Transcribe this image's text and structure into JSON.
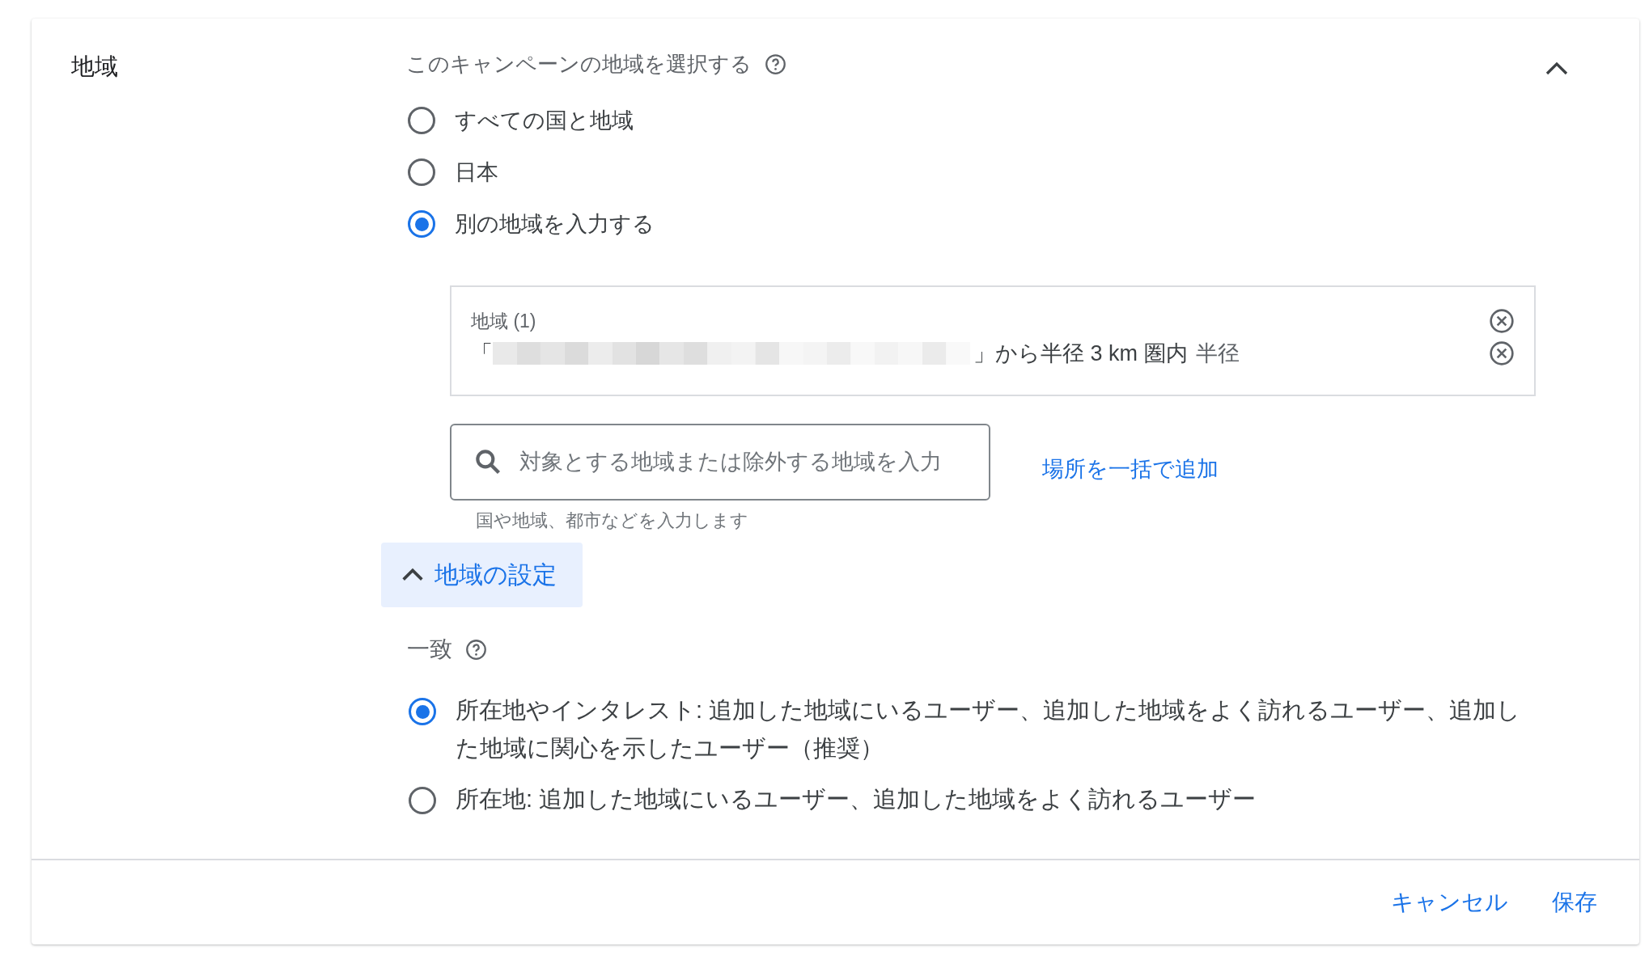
{
  "section": {
    "title": "地域",
    "expanded": true
  },
  "prompt": {
    "label": "このキャンペーンの地域を選択する"
  },
  "region_options": [
    {
      "label": "すべての国と地域",
      "selected": false
    },
    {
      "label": "日本",
      "selected": false
    },
    {
      "label": "別の地域を入力する",
      "selected": true
    }
  ],
  "locations": {
    "heading": "地域 (1)",
    "items": [
      {
        "open_quote": "「",
        "text": "」から半径 3 km 圏内",
        "extra": "半径"
      }
    ]
  },
  "search": {
    "placeholder": "対象とする地域または除外する地域を入力",
    "helper": "国や地域、都市などを入力します"
  },
  "bulk_add_link": "場所を一括で追加",
  "settings_toggle": {
    "label": "地域の設定",
    "expanded": true
  },
  "match": {
    "label": "一致",
    "options": [
      {
        "label": "所在地やインタレスト: 追加した地域にいるユーザー、追加した地域をよく訪れるユーザー、追加した地域に関心を示したユーザー（推奨）",
        "selected": true
      },
      {
        "label": "所在地: 追加した地域にいるユーザー、追加した地域をよく訪れるユーザー",
        "selected": false
      }
    ]
  },
  "footer": {
    "buttons": [
      {
        "label": "キャンセル"
      },
      {
        "label": "保存"
      }
    ]
  }
}
